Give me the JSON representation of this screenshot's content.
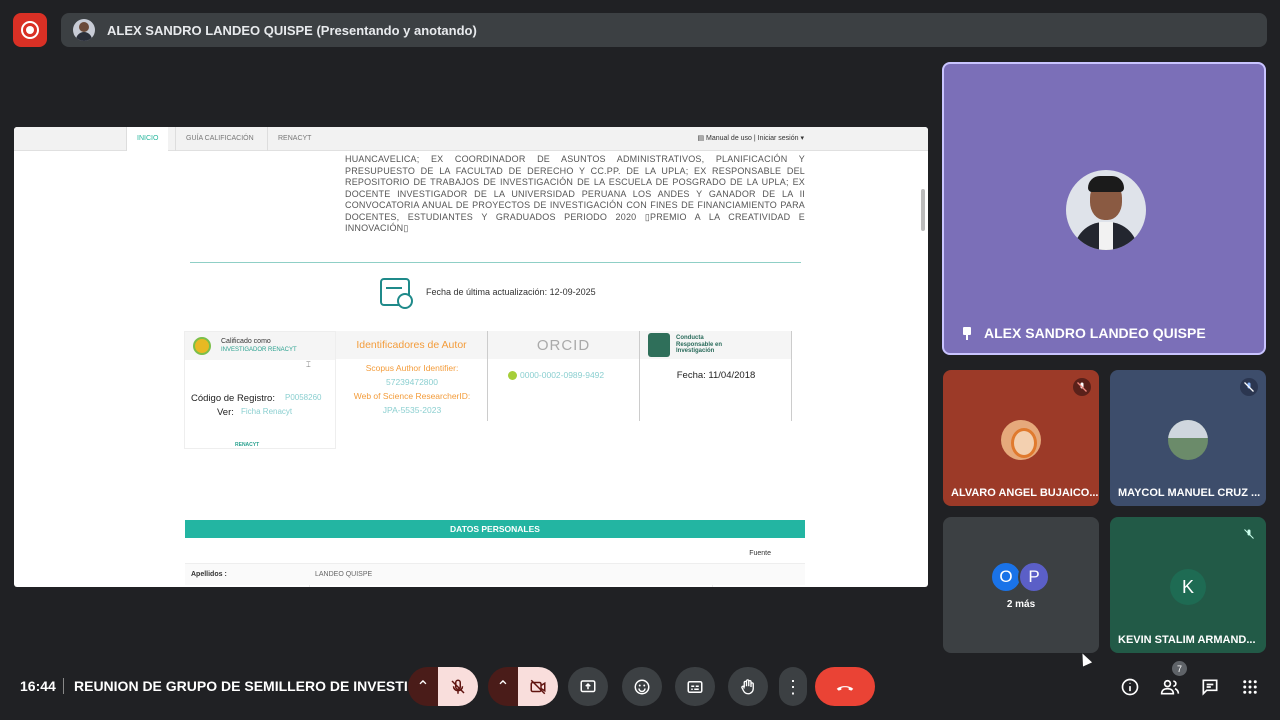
{
  "presenter_bar": {
    "label": "ALEX SANDRO LANDEO QUISPE (Presentando y anotando)"
  },
  "shared": {
    "nav": {
      "tabs": [
        "INICIO",
        "GUÍA CALIFICACIÓN",
        "RENACYT"
      ],
      "manual": "Manual de uso",
      "login": "Iniciar sesión"
    },
    "paragraph": "HUANCAVELICA; EX COORDINADOR DE ASUNTOS ADMINISTRATIVOS, PLANIFICACIÓN Y PRESUPUESTO DE LA FACULTAD DE DERECHO Y CC.PP. DE LA UPLA; EX RESPONSABLE DEL REPOSITORIO DE TRABAJOS DE INVESTIGACIÓN DE LA ESCUELA DE POSGRADO DE LA UPLA; EX DOCENTE INVESTIGADOR DE LA UNIVERSIDAD PERUANA LOS ANDES Y GANADOR DE LA II CONVOCATORIA ANUAL DE PROYECTOS DE INVESTIGACIÓN CON FINES DE FINANCIAMIENTO PARA DOCENTES, ESTUDIANTES Y GRADUADOS PERIODO 2020 ▯PREMIO A LA CREATIVIDAD E INNOVACIÓN▯",
    "fecha": "Fecha de última actualización: 12-09-2025",
    "card1": {
      "line1": "Calificado como",
      "line2": "INVESTIGADOR RENACYT",
      "reg_label": "Código de Registro:",
      "reg_value": "P0058260",
      "ver_label": "Ver:",
      "ver_value": "Ficha Renacyt",
      "logo": "RENACYT"
    },
    "card2": {
      "title": "Identificadores de Autor",
      "scopus_label": "Scopus Author Identifier:",
      "scopus_value": "57239472800",
      "wos_label": "Web of Science ResearcherID:",
      "wos_value": "JPA-5535-2023"
    },
    "card3": {
      "title": "ORCID",
      "orcid": "0000-0002-0989-9492"
    },
    "card4": {
      "title": "Conducta Responsable en Investigación",
      "fecha": "Fecha:  11/04/2018"
    },
    "section": "DATOS PERSONALES",
    "table": {
      "fuente": "Fuente",
      "apellidos_label": "Apellidos :",
      "apellidos_value": "LANDEO QUISPE"
    }
  },
  "participants": {
    "main": "ALEX SANDRO LANDEO QUISPE",
    "t2": "ALVARO ANGEL BUJAICO...",
    "t3": "MAYCOL MANUEL CRUZ ...",
    "more": {
      "o": "O",
      "p": "P",
      "label": "2 más"
    },
    "t5": {
      "initial": "K",
      "name": "KEVIN STALIM ARMAND..."
    }
  },
  "bottom": {
    "time": "16:44",
    "meeting": "REUNION DE GRUPO DE SEMILLERO DE INVESTI...",
    "people_count": "7"
  }
}
